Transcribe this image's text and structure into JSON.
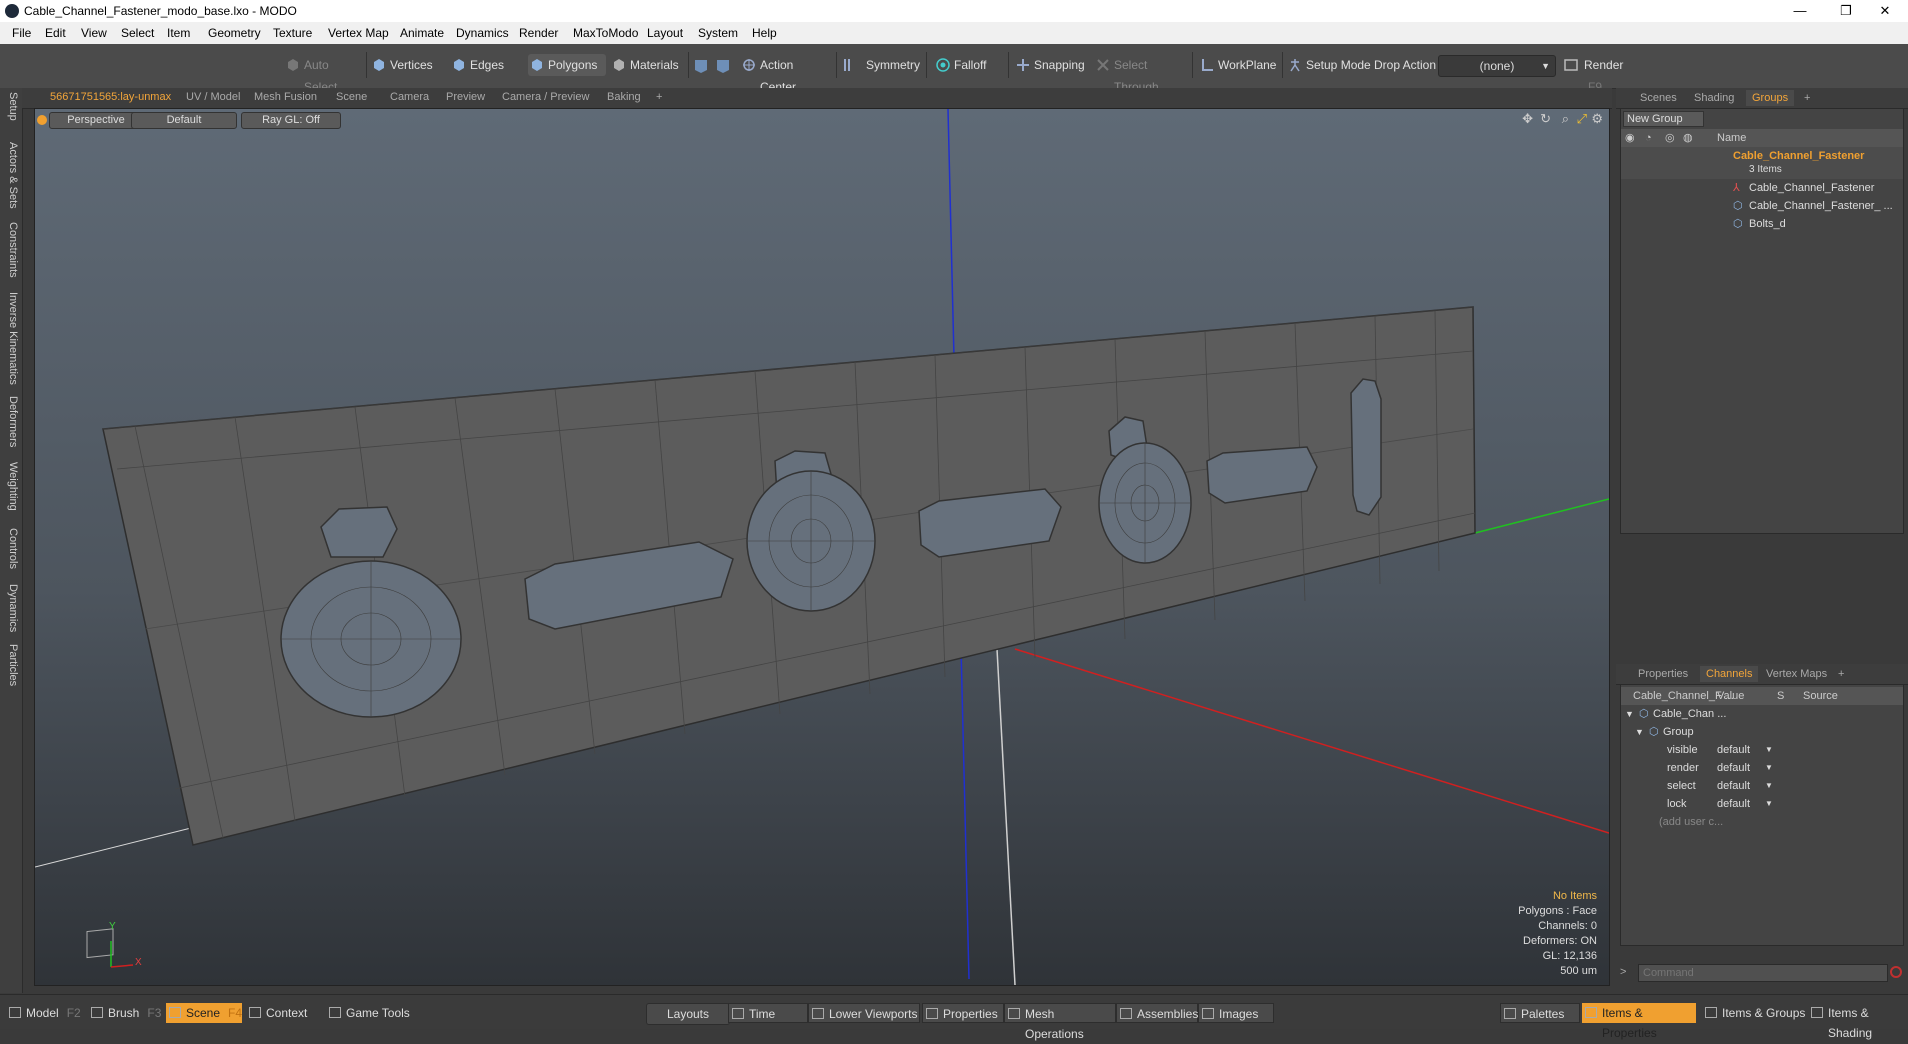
{
  "window": {
    "title": "Cable_Channel_Fastener_modo_base.lxo - MODO",
    "minimize": "—",
    "restore": "❐",
    "close": "✕"
  },
  "menu": [
    "File",
    "Edit",
    "View",
    "Select",
    "Item",
    "Geometry",
    "Texture",
    "Vertex Map",
    "Animate",
    "Dynamics",
    "Render",
    "MaxToModo",
    "Layout",
    "System",
    "Help"
  ],
  "toolbar": {
    "auto_select": "Auto Select",
    "vertices": "Vertices",
    "edges": "Edges",
    "polygons": "Polygons",
    "materials": "Materials",
    "action_center": "Action Center",
    "symmetry": "Symmetry",
    "falloff": "Falloff",
    "snapping": "Snapping",
    "select_through": "Select Through",
    "workplane": "WorkPlane",
    "setup_mode": "Setup Mode",
    "drop_action": "Drop Action",
    "drop_action_value": "(none)",
    "render": "Render",
    "render_key": "F9"
  },
  "left_tabs": [
    "Setup",
    "Actors & Sets",
    "Constraints",
    "Inverse Kinematics",
    "Deformers",
    "Weighting",
    "Controls",
    "Dynamics",
    "Particles"
  ],
  "viewport_tabs": {
    "tabs": [
      "56671751565:lay-unmax",
      "UV / Model",
      "Mesh Fusion",
      "Scene",
      "Camera",
      "Preview",
      "Camera / Preview",
      "Baking"
    ],
    "add": "+"
  },
  "viewport": {
    "view": "Perspective",
    "shading": "Default",
    "raygl": "Ray GL: Off",
    "info": {
      "no_items": "No Items",
      "polygons": "Polygons : Face",
      "channels": "Channels: 0",
      "deformers": "Deformers: ON",
      "gl": "GL: 12,136",
      "scale": "500 um"
    },
    "axis_y": "Y",
    "axis_x": "X"
  },
  "right_top": {
    "tabs": [
      "Scenes",
      "Shading",
      "Groups"
    ],
    "active_tab": "Groups",
    "new_group": "New Group",
    "name_header": "Name",
    "group": {
      "name": "Cable_Channel_Fastener",
      "count": "3 Items",
      "children": [
        "Cable_Channel_Fastener",
        "Cable_Channel_Fastener_ ...",
        "Bolts_d"
      ]
    }
  },
  "right_bottom": {
    "tabs": [
      "Properties",
      "Channels",
      "Vertex Maps"
    ],
    "active_tab": "Channels",
    "headers": {
      "name": "Cable_Channel_F ...",
      "value": "Value",
      "s": "S",
      "source": "Source"
    },
    "item": "Cable_Chan ...",
    "group": "Group",
    "channels": [
      {
        "name": "visible",
        "value": "default"
      },
      {
        "name": "render",
        "value": "default"
      },
      {
        "name": "select",
        "value": "default"
      },
      {
        "name": "lock",
        "value": "default"
      }
    ],
    "add_user": "(add user c...",
    "command_placeholder": "Command"
  },
  "bottom": {
    "model": "Model",
    "model_key": "F2",
    "brush": "Brush",
    "brush_key": "F3",
    "scene": "Scene",
    "scene_key": "F4",
    "context": "Context",
    "game_tools": "Game Tools",
    "layouts": "Layouts",
    "time": "Time",
    "lower_viewports": "Lower Viewports",
    "properties": "Properties",
    "mesh_operations": "Mesh Operations",
    "assemblies": "Assemblies",
    "images": "Images",
    "palettes": "Palettes",
    "items_properties": "Items & Properties",
    "items_groups": "Items & Groups",
    "items_shading": "Items & Shading"
  },
  "colors": {
    "accent": "#f0a030",
    "x_axis": "#d02020",
    "y_axis": "#20c020",
    "z_axis": "#2030d0"
  }
}
